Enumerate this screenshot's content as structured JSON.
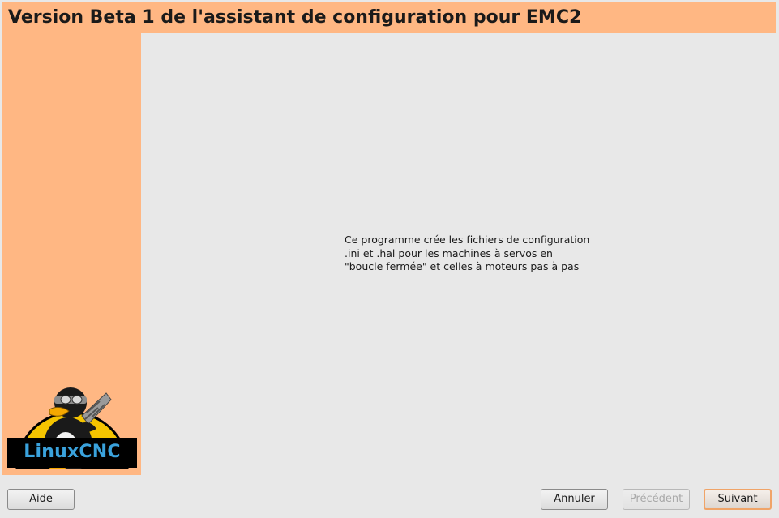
{
  "header": {
    "title": "Version Beta 1 de l'assistant de configuration pour EMC2"
  },
  "sidebar": {
    "logo_text": "LinuxCNC"
  },
  "content": {
    "lines": [
      "Ce programme crée les fichiers de configuration",
      ".ini et .hal pour les machines à servos en",
      "\"boucle fermée\" et celles à moteurs pas à pas"
    ]
  },
  "buttons": {
    "help": {
      "pre": "Ai",
      "mnemonic": "d",
      "post": "e"
    },
    "cancel": {
      "pre": "",
      "mnemonic": "A",
      "post": "nnuler"
    },
    "previous": {
      "pre": "",
      "mnemonic": "P",
      "post": "récédent"
    },
    "next": {
      "pre": "",
      "mnemonic": "S",
      "post": "uivant"
    }
  },
  "colors": {
    "accent": "#ffb783",
    "background": "#e8e8e8",
    "logo_text": "#3aa2dc",
    "logo_yellow": "#f5c400"
  }
}
